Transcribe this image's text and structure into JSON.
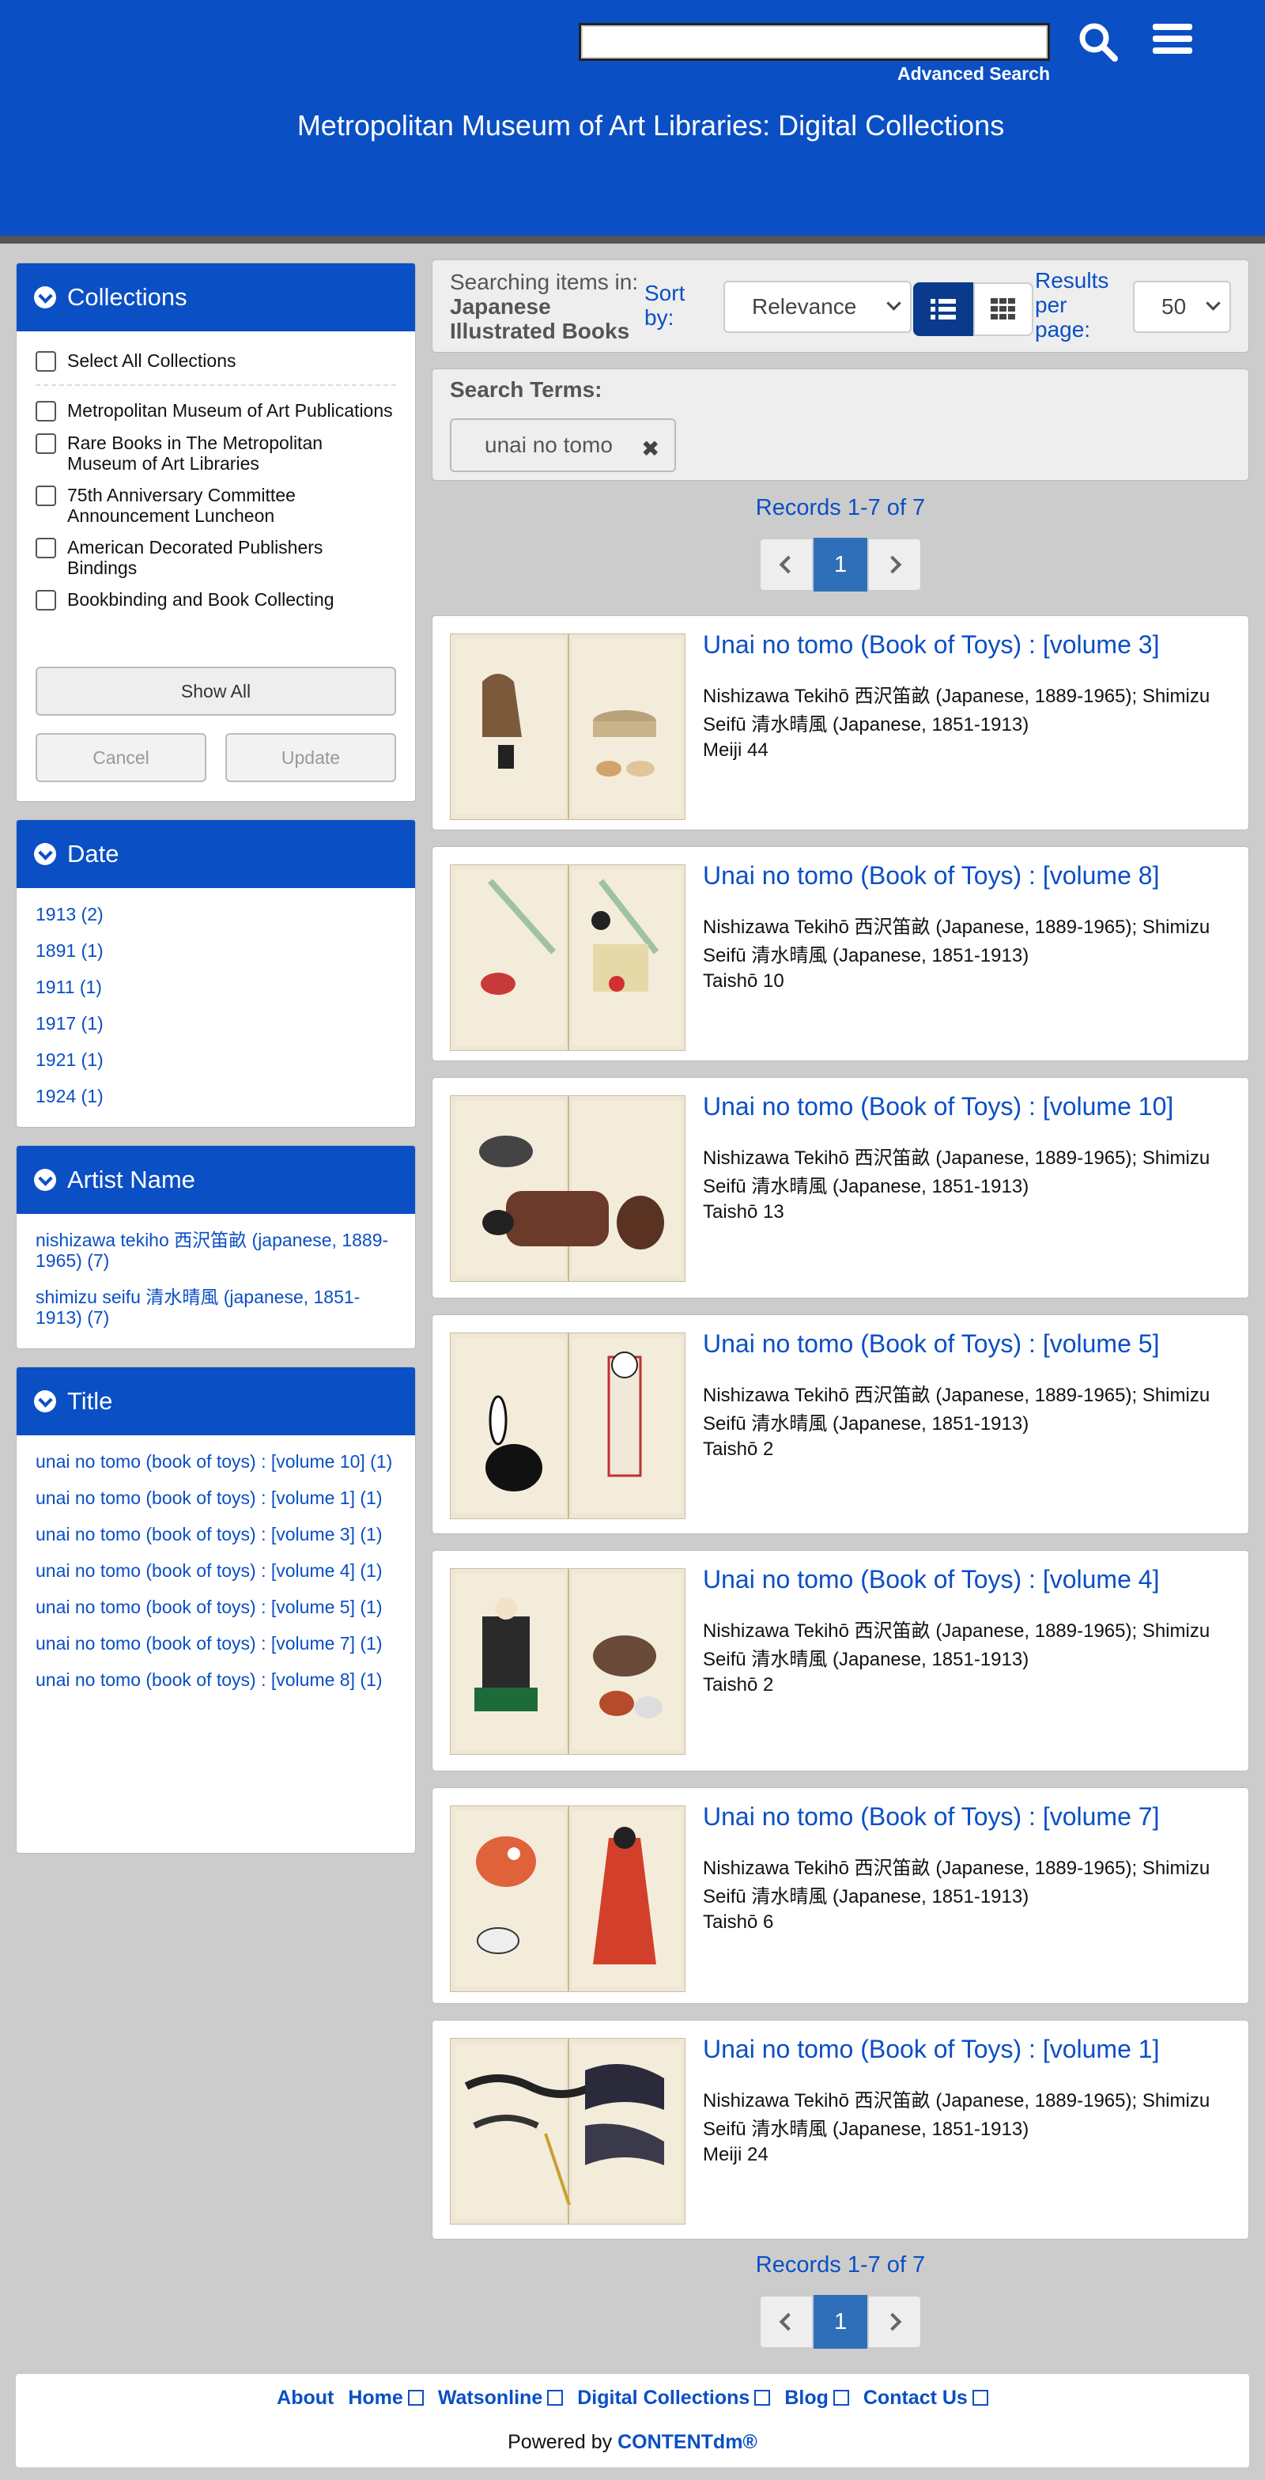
{
  "header": {
    "site_title": "Metropolitan Museum of Art Libraries: Digital Collections",
    "advanced_search": "Advanced Search",
    "search_value": ""
  },
  "sidebar": {
    "collections": {
      "title": "Collections",
      "select_all": "Select All Collections",
      "items": [
        "Metropolitan Museum of Art Publications",
        "Rare Books in The Metropolitan Museum of Art Libraries",
        "75th Anniversary Committee Announcement Luncheon",
        "American Decorated Publishers Bindings",
        "Bookbinding and Book Collecting"
      ],
      "show_all": "Show All",
      "cancel": "Cancel",
      "update": "Update"
    },
    "date": {
      "title": "Date",
      "items": [
        "1913 (2)",
        "1891 (1)",
        "1911 (1)",
        "1917 (1)",
        "1921 (1)",
        "1924 (1)"
      ]
    },
    "artist": {
      "title": "Artist Name",
      "items": [
        "nishizawa tekiho 西沢笛畝 (japanese, 1889-1965) (7)",
        "shimizu seifu 清水晴風 (japanese, 1851-1913) (7)"
      ]
    },
    "title_facet": {
      "title": "Title",
      "items": [
        "unai no tomo (book of toys) : [volume 10] (1)",
        "unai no tomo (book of toys) : [volume 1] (1)",
        "unai no tomo (book of toys) : [volume 3] (1)",
        "unai no tomo (book of toys) : [volume 4] (1)",
        "unai no tomo (book of toys) : [volume 5] (1)",
        "unai no tomo (book of toys) : [volume 7] (1)",
        "unai no tomo (book of toys) : [volume 8] (1)"
      ]
    }
  },
  "toolbar": {
    "searching_prefix": "Searching items in:",
    "searching_collection_line1": "Japanese",
    "searching_collection_line2": "Illustrated Books",
    "sort_label_line1": "Sort",
    "sort_label_line2": "by:",
    "sort_value": "Relevance",
    "rpp_line1": "Results",
    "rpp_line2": "per",
    "rpp_line3": "page:",
    "rpp_value": "50"
  },
  "search_terms": {
    "title": "Search Terms:",
    "term": "unai no tomo"
  },
  "pagination": {
    "records_text": "Records 1-7 of 7",
    "current_page": "1"
  },
  "results": [
    {
      "title": "Unai no tomo (Book of Toys) : [volume 3]",
      "creator": "Nishizawa Tekihō 西沢笛畝 (Japanese, 1889-1965); Shimizu Seifū 清水晴風 (Japanese, 1851-1913)",
      "date": "Meiji 44"
    },
    {
      "title": "Unai no tomo (Book of Toys) : [volume 8]",
      "creator": "Nishizawa Tekihō 西沢笛畝 (Japanese, 1889-1965); Shimizu Seifū 清水晴風 (Japanese, 1851-1913)",
      "date": "Taishō 10"
    },
    {
      "title": "Unai no tomo (Book of Toys) : [volume 10]",
      "creator": "Nishizawa Tekihō 西沢笛畝 (Japanese, 1889-1965); Shimizu Seifū 清水晴風 (Japanese, 1851-1913)",
      "date": "Taishō 13"
    },
    {
      "title": "Unai no tomo (Book of Toys) : [volume 5]",
      "creator": "Nishizawa Tekihō 西沢笛畝 (Japanese, 1889-1965); Shimizu Seifū 清水晴風 (Japanese, 1851-1913)",
      "date": "Taishō 2"
    },
    {
      "title": "Unai no tomo (Book of Toys) : [volume 4]",
      "creator": "Nishizawa Tekihō 西沢笛畝 (Japanese, 1889-1965); Shimizu Seifū 清水晴風 (Japanese, 1851-1913)",
      "date": "Taishō 2"
    },
    {
      "title": "Unai no tomo (Book of Toys) : [volume 7]",
      "creator": "Nishizawa Tekihō 西沢笛畝 (Japanese, 1889-1965); Shimizu Seifū 清水晴風 (Japanese, 1851-1913)",
      "date": "Taishō 6"
    },
    {
      "title": "Unai no tomo (Book of Toys) : [volume 1]",
      "creator": "Nishizawa Tekihō 西沢笛畝 (Japanese, 1889-1965); Shimizu Seifū 清水晴風 (Japanese, 1851-1913)",
      "date": "Meiji 24"
    }
  ],
  "footer": {
    "links": [
      "About",
      "Home",
      "Watsonline",
      "Digital Collections",
      "Blog",
      "Contact Us"
    ],
    "powered_prefix": "Powered by",
    "powered_brand": "CONTENTdm®"
  },
  "colors": {
    "brand_blue": "#0a4fc4",
    "background": "#cccccc"
  }
}
